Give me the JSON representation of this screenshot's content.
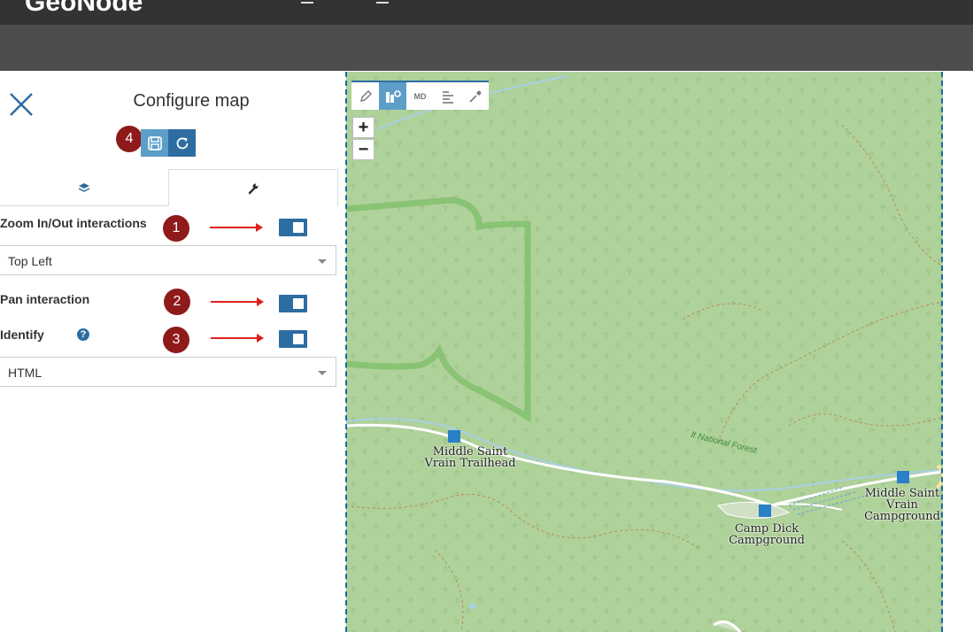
{
  "app": {
    "logo": "GeoNode"
  },
  "panel": {
    "title": "Configure map",
    "badges": [
      "1",
      "2",
      "3",
      "4"
    ],
    "zoom_label": "Zoom In/Out interactions",
    "zoom_position": "Top Left",
    "pan_label": "Pan interaction",
    "identify_label": "Identify",
    "identify_help": "?",
    "identify_format": "HTML"
  },
  "map": {
    "tools": {
      "md_label": "MD"
    },
    "zoom_in": "+",
    "zoom_out": "−",
    "labels": {
      "forest": "lt National Forest",
      "trailhead_1": "Middle Saint",
      "trailhead_2": "Vrain Trailhead",
      "camp_dick_1": "Camp Dick",
      "camp_dick_2": "Campground",
      "msv_camp_1": "Middle Saint",
      "msv_camp_2": "Vrain",
      "msv_camp_3": "Campground"
    },
    "colors": {
      "land": "#afd19a",
      "boundary": "#7fbf6a",
      "stream": "#a8d0e6",
      "road": "#ffffff",
      "accent": "#2d6da1"
    }
  },
  "colors": {
    "topbar": "#333333",
    "toolbar": "#4d4d4d",
    "badge": "#8f1a1a",
    "toggle": "#2d6da1",
    "arrow": "#e02020"
  }
}
